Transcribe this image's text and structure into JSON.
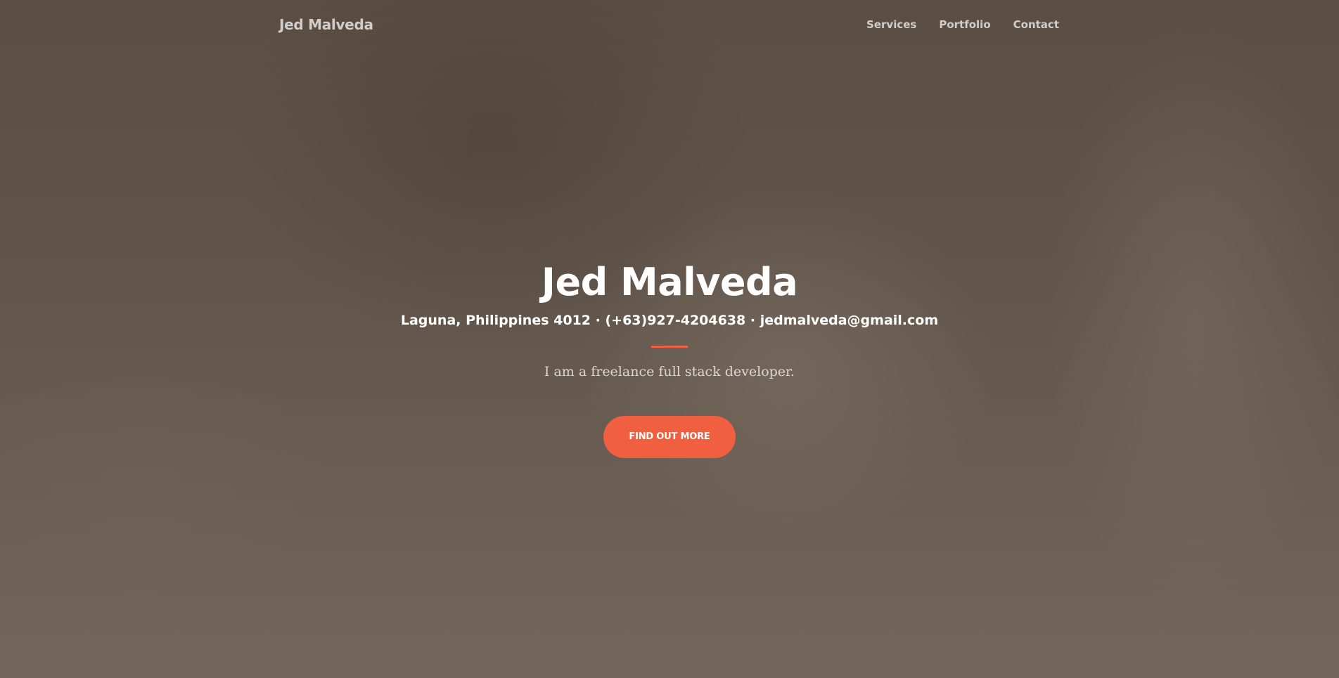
{
  "navbar": {
    "brand": "Jed Malveda",
    "links": [
      "Services",
      "Portfolio",
      "Contact"
    ]
  },
  "masthead": {
    "title": "Jed Malveda",
    "contact_line": "Laguna, Philippines 4012 · (+63)927-4204638 · jedmalveda@gmail.com",
    "lead": "I am a freelance full stack developer.",
    "cta_label": "FIND OUT MORE"
  },
  "colors": {
    "accent": "#f05f40",
    "background_tone": "#62564d",
    "text": "#ffffff"
  }
}
